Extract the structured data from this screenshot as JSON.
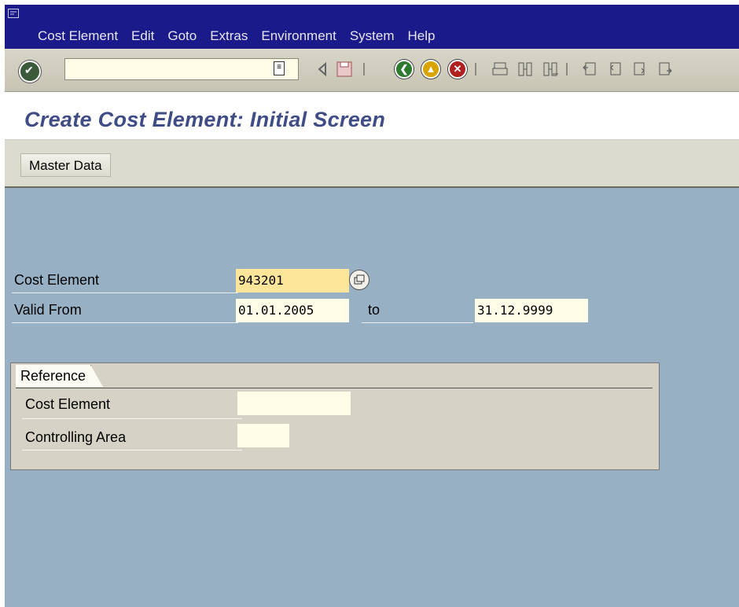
{
  "menu": [
    "Cost Element",
    "Edit",
    "Goto",
    "Extras",
    "Environment",
    "System",
    "Help"
  ],
  "toolbar": {
    "command_field_value": "",
    "icons": [
      "enter-icon",
      "back-icon",
      "exit-icon",
      "cancel-icon",
      "print-icon",
      "find-icon",
      "find-next-icon",
      "first-page-icon",
      "previous-page-icon",
      "next-page-icon",
      "last-page-icon"
    ]
  },
  "title": "Create Cost Element: Initial Screen",
  "app_toolbar": {
    "master_data_label": "Master Data"
  },
  "form": {
    "cost_element_label": "Cost Element",
    "cost_element_value": "943201",
    "valid_from_label": "Valid From",
    "valid_from_value": "01.01.2005",
    "to_label": "to",
    "valid_to_value": "31.12.9999"
  },
  "reference": {
    "tab_label": "Reference",
    "cost_element_label": "Cost Element",
    "cost_element_value": "",
    "controlling_area_label": "Controlling Area",
    "controlling_area_value": ""
  },
  "colors": {
    "menubar": "#1a1a8a",
    "title": "#3f4c86",
    "work_area": "#97b0c4",
    "field_focus": "#fde59a",
    "field": "#fffde8"
  }
}
